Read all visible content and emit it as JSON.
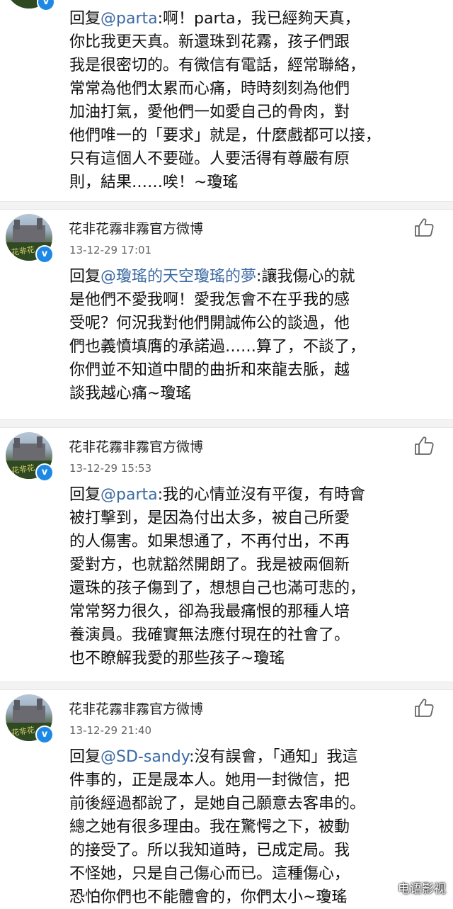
{
  "comments": [
    {
      "reply_prefix": "回复",
      "mention": "@parta",
      "text": ":啊！parta，我已經夠天真，\n你比我更天真。新還珠到花霧，孩子們跟\n我是很密切的。有微信有電話，經常聯絡，\n常常為他們太累而心痛，時時刻刻為他們\n加油打氣，愛他們一如愛自己的骨肉，對\n他們唯一的「要求」就是，什麼戲都可以接，\n只有這個人不要碰。人要活得有尊嚴有原\n則，結果……唉！~瓊瑤"
    },
    {
      "username": "花非花霧非霧官方微博",
      "timestamp": "13-12-29 17:01",
      "reply_prefix": "回复",
      "mention": "@瓊瑤的天空瓊瑤的夢",
      "text": ":讓我傷心的就\n是他們不愛我啊！愛我怎會不在乎我的感\n受呢？何況我對他們開誠佈公的談過，他\n們也義憤填膺的承諾過……算了，不談了，\n你們並不知道中間的曲折和來龍去脈，越\n談我越心痛~瓊瑤"
    },
    {
      "username": "花非花霧非霧官方微博",
      "timestamp": "13-12-29 15:53",
      "reply_prefix": "回复",
      "mention": "@parta",
      "text": ":我的心情並沒有平復，有時會\n被打擊到，是因為付出太多，被自己所愛\n的人傷害。如果想通了，不再付出，不再\n愛對方，也就豁然開朗了。我是被兩個新\n還珠的孩子傷到了，想想自己也滿可悲的，\n常常努力很久，卻為我最痛恨的那種人培\n養演員。我確實無法應付現在的社會了。\n也不瞭解我愛的那些孩子~瓊瑤"
    },
    {
      "username": "花非花霧非霧官方微博",
      "timestamp": "13-12-29 21:40",
      "reply_prefix": "回复",
      "mention": "@SD-sandy",
      "text": ":沒有誤會，「通知」我這\n件事的，正是晟本人。她用一封微信，把\n前後經過都說了，是她自己願意去客串的。\n總之她有很多理由。我在驚愕之下，被動\n的接受了。所以我知道時，已成定局。我\n不怪她，只是自己傷心而已。這種傷心，\n恐怕你們也不能體會的，你們太小~瓊瑤"
    }
  ],
  "avatar_watermark": "花非花",
  "verified_badge": "v",
  "icons": {
    "like": "thumbs-up-icon",
    "verified": "verified-badge-icon"
  },
  "watermark": "电语影视",
  "colors": {
    "mention": "#3b6aa3",
    "divider": "#f3f3f3",
    "badge": "#1e88e5"
  }
}
